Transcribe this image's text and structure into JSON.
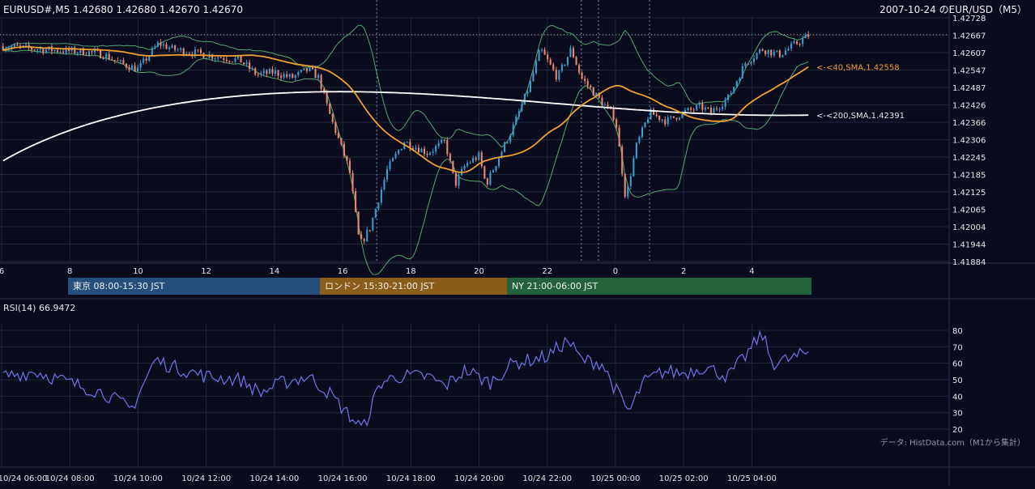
{
  "header": {
    "ohlc_label": "EURUSD#,M5 1.42680 1.42680 1.42670 1.42670",
    "date_title": "2007-10-24 のEUR/USD（M5）"
  },
  "colors": {
    "background": "#0b0b1e",
    "grid": "#1d2a3a",
    "candle_up": "#3d9ad1",
    "candle_down": "#e8896d",
    "bollinger": "#52a86a",
    "sma40": "#f0a030",
    "sma200": "#ffffff",
    "rsi": "#6f74e8",
    "tokyo": "#244f7c",
    "london": "#8a5d18",
    "ny": "#24623e"
  },
  "sessions": [
    {
      "label": "東京 08:00-15:30 JST",
      "color": "#244f7c"
    },
    {
      "label": "ロンドン 15:30-21:00 JST",
      "color": "#8a5d18"
    },
    {
      "label": "NY 21:00-06:00 JST",
      "color": "#24623e"
    }
  ],
  "rsi_label": "RSI(14) 66.9472",
  "data_source": "データ: HistData.com（M1から集計）",
  "chart_data": [
    {
      "type": "candlestick",
      "title": "EUR/USD M5",
      "ylim": [
        1.41884,
        1.42728
      ],
      "y_ticks": [
        "1.42728",
        "1.42667",
        "1.42607",
        "1.42547",
        "1.42487",
        "1.42426",
        "1.42366",
        "1.42306",
        "1.42245",
        "1.42185",
        "1.42125",
        "1.42065",
        "1.42004",
        "1.41944",
        "1.41884"
      ],
      "x_hour_ticks": [
        "6",
        "8",
        "10",
        "12",
        "14",
        "16",
        "18",
        "20",
        "22",
        "0",
        "2",
        "4"
      ],
      "x_date_ticks": [
        "10/24 06:00",
        "10/24 08:00",
        "10/24 10:00",
        "10/24 12:00",
        "10/24 14:00",
        "10/24 16:00",
        "10/24 18:00",
        "10/24 20:00",
        "10/24 22:00",
        "10/25 00:00",
        "10/25 02:00",
        "10/25 04:00"
      ],
      "x_range_hours": [
        6,
        29.7
      ],
      "close_anchors": [
        [
          6.0,
          1.4263
        ],
        [
          7.0,
          1.4262
        ],
        [
          8.5,
          1.4261
        ],
        [
          9.0,
          1.426
        ],
        [
          9.5,
          1.4257
        ],
        [
          10.0,
          1.4255
        ],
        [
          10.6,
          1.4264
        ],
        [
          11.0,
          1.4262
        ],
        [
          12.0,
          1.426
        ],
        [
          13.0,
          1.4258
        ],
        [
          13.5,
          1.4253
        ],
        [
          14.0,
          1.4254
        ],
        [
          14.5,
          1.4252
        ],
        [
          15.0,
          1.4255
        ],
        [
          15.3,
          1.4252
        ],
        [
          15.6,
          1.424
        ],
        [
          16.2,
          1.422
        ],
        [
          16.5,
          1.4194
        ],
        [
          16.8,
          1.42
        ],
        [
          17.3,
          1.422
        ],
        [
          17.8,
          1.423
        ],
        [
          18.5,
          1.4226
        ],
        [
          19.0,
          1.423
        ],
        [
          19.3,
          1.4215
        ],
        [
          19.6,
          1.4222
        ],
        [
          20.0,
          1.4225
        ],
        [
          20.2,
          1.4215
        ],
        [
          20.6,
          1.4225
        ],
        [
          21.0,
          1.4235
        ],
        [
          21.5,
          1.425
        ],
        [
          21.8,
          1.4262
        ],
        [
          22.3,
          1.4252
        ],
        [
          22.7,
          1.4262
        ],
        [
          23.0,
          1.4252
        ],
        [
          23.5,
          1.4245
        ],
        [
          24.0,
          1.4238
        ],
        [
          24.3,
          1.421
        ],
        [
          24.6,
          1.4228
        ],
        [
          25.0,
          1.424
        ],
        [
          25.5,
          1.4237
        ],
        [
          26.0,
          1.424
        ],
        [
          26.5,
          1.4242
        ],
        [
          26.8,
          1.424
        ],
        [
          27.3,
          1.4245
        ],
        [
          27.8,
          1.4257
        ],
        [
          28.3,
          1.4262
        ],
        [
          28.8,
          1.426
        ],
        [
          29.7,
          1.4267
        ]
      ],
      "overlays": [
        {
          "label": "<-<40,SMA,1.42558",
          "period": 40,
          "last_value": 1.42558
        },
        {
          "label": "<-<200,SMA,1.42391",
          "period": 200,
          "last_value": 1.42391
        }
      ],
      "session_marker_hours": [
        17.0,
        23.0,
        23.5,
        25.0
      ]
    },
    {
      "type": "line",
      "title": "RSI(14)",
      "ylim": [
        20,
        80
      ],
      "y_ticks": [
        80,
        70,
        60,
        50,
        40,
        30,
        20
      ],
      "last_value": 66.9472,
      "anchors": [
        [
          6.0,
          52
        ],
        [
          7.0,
          55
        ],
        [
          8.0,
          48
        ],
        [
          9.0,
          42
        ],
        [
          9.8,
          32
        ],
        [
          10.5,
          62
        ],
        [
          11.0,
          58
        ],
        [
          12.0,
          52
        ],
        [
          13.0,
          50
        ],
        [
          13.6,
          42
        ],
        [
          14.2,
          48
        ],
        [
          15.0,
          52
        ],
        [
          15.6,
          42
        ],
        [
          16.2,
          28
        ],
        [
          16.6,
          20
        ],
        [
          17.1,
          48
        ],
        [
          17.6,
          52
        ],
        [
          18.5,
          52
        ],
        [
          19.0,
          46
        ],
        [
          19.6,
          56
        ],
        [
          20.3,
          48
        ],
        [
          21.0,
          60
        ],
        [
          22.0,
          64
        ],
        [
          22.6,
          74
        ],
        [
          23.0,
          62
        ],
        [
          23.6,
          60
        ],
        [
          24.0,
          44
        ],
        [
          24.4,
          30
        ],
        [
          24.8,
          48
        ],
        [
          25.4,
          55
        ],
        [
          26.0,
          54
        ],
        [
          26.6,
          58
        ],
        [
          27.3,
          52
        ],
        [
          27.8,
          64
        ],
        [
          28.3,
          78
        ],
        [
          28.6,
          60
        ],
        [
          29.2,
          63
        ],
        [
          29.7,
          67
        ]
      ]
    }
  ]
}
